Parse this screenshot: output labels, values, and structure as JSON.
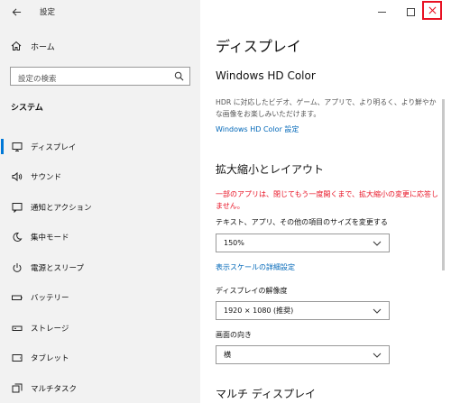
{
  "window": {
    "title": "設定"
  },
  "sidebar": {
    "home_label": "ホーム",
    "search_placeholder": "設定の検索",
    "section_title": "システム",
    "items": [
      {
        "label": "ディスプレイ",
        "icon": "monitor-icon",
        "active": true
      },
      {
        "label": "サウンド",
        "icon": "speaker-icon",
        "active": false
      },
      {
        "label": "通知とアクション",
        "icon": "notification-icon",
        "active": false
      },
      {
        "label": "集中モード",
        "icon": "moon-icon",
        "active": false
      },
      {
        "label": "電源とスリープ",
        "icon": "power-icon",
        "active": false
      },
      {
        "label": "バッテリー",
        "icon": "battery-icon",
        "active": false
      },
      {
        "label": "ストレージ",
        "icon": "storage-icon",
        "active": false
      },
      {
        "label": "タブレット",
        "icon": "tablet-icon",
        "active": false
      },
      {
        "label": "マルチタスク",
        "icon": "multitask-icon",
        "active": false
      }
    ]
  },
  "main": {
    "page_title": "ディスプレイ",
    "hd_color": {
      "heading": "Windows HD Color",
      "description": "HDR に対応したビデオ、ゲーム、アプリで、より明るく、より鮮やかな画像をお楽しみいただけます。",
      "link": "Windows HD Color 設定"
    },
    "scale": {
      "heading": "拡大縮小とレイアウト",
      "warning": "一部のアプリは、閉じてもう一度開くまで、拡大縮小の変更に応答しません。",
      "size_label": "テキスト、アプリ、その他の項目のサイズを変更する",
      "size_value": "150%",
      "advanced_link": "表示スケールの詳細設定",
      "resolution_label": "ディスプレイの解像度",
      "resolution_value": "1920 × 1080 (推奨)",
      "orientation_label": "画面の向き",
      "orientation_value": "横"
    },
    "multi_display_heading": "マルチ ディスプレイ"
  },
  "colors": {
    "accent": "#0078d7",
    "link": "#0067b8",
    "warning": "#e81123",
    "sidebar_bg": "#f2f2f2"
  }
}
